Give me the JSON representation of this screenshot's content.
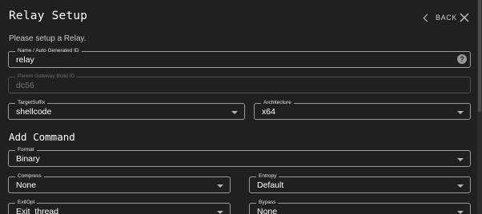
{
  "header": {
    "title": "Relay Setup",
    "back_label": "BACK",
    "subtitle": "Please setup a Relay."
  },
  "fields": {
    "name": {
      "label": "Name / Auto Generated ID",
      "value": "relay"
    },
    "parent_gateway": {
      "label": "Parent Gateway Build ID",
      "value": "dc56"
    },
    "target_suffix": {
      "label": "TargetSuffix",
      "value": "shellcode"
    },
    "architecture": {
      "label": "Architecture",
      "value": "x64"
    }
  },
  "add_command": {
    "title": "Add Command",
    "format": {
      "label": "Format",
      "value": "Binary"
    },
    "compress": {
      "label": "Compress",
      "value": "None"
    },
    "entropy": {
      "label": "Entropy",
      "value": "Default"
    },
    "exitopt": {
      "label": "ExitOpt",
      "value": "Exit_thread"
    },
    "bypass": {
      "label": "Bypass",
      "value": "None"
    }
  },
  "icons": {
    "help": "?",
    "back": "chevron-left-icon",
    "close": "close-icon"
  }
}
